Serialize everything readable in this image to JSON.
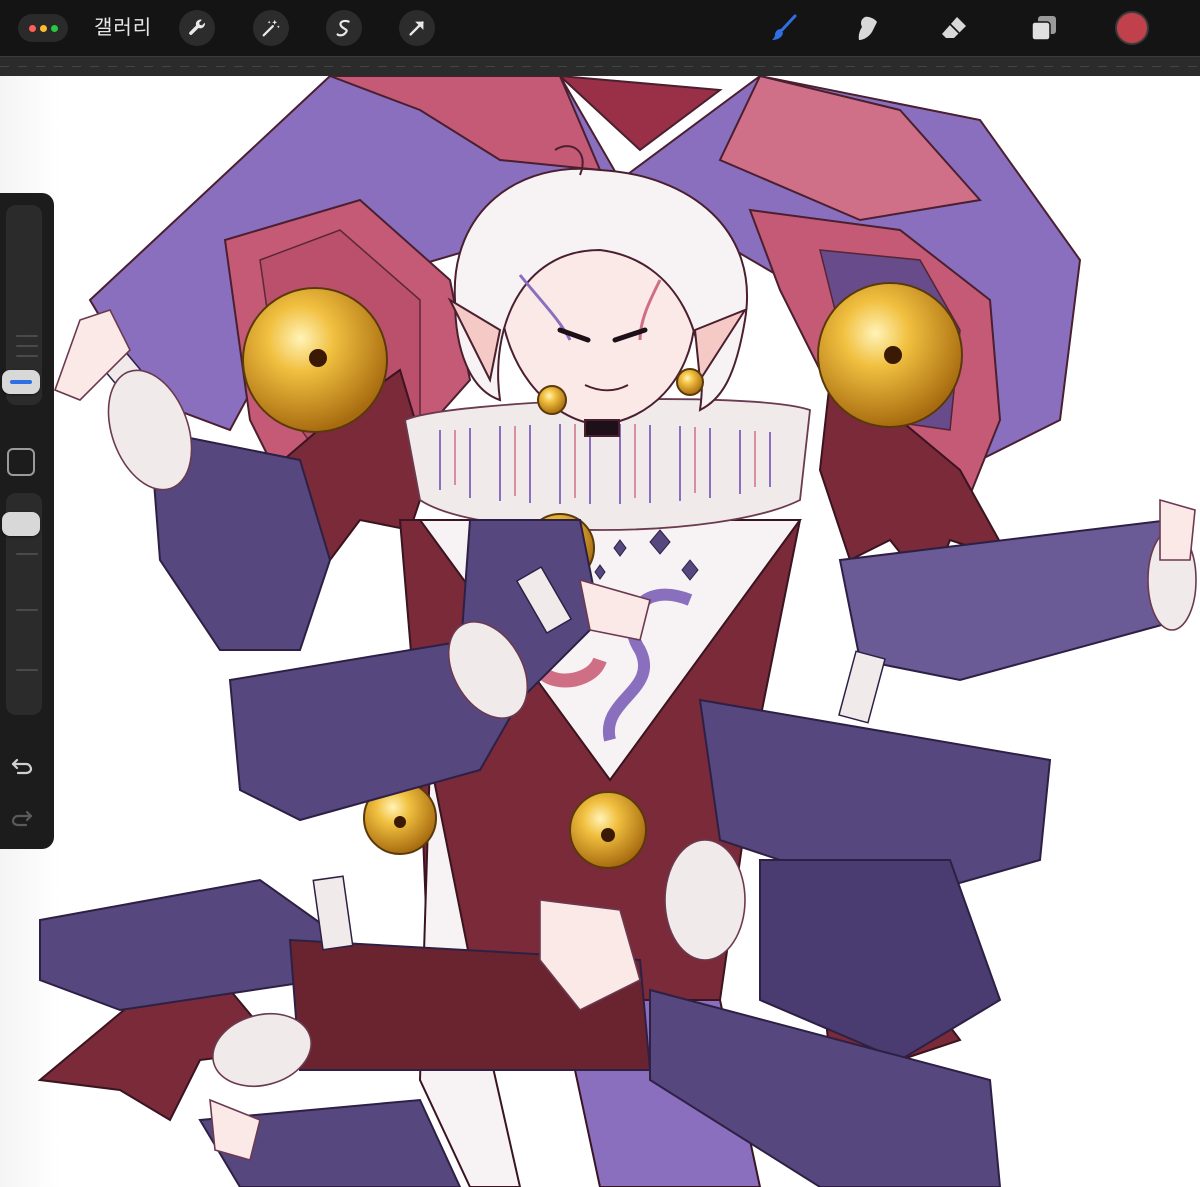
{
  "window": {
    "controls_icon": "three-dots-icon",
    "dot_colors": [
      "#ff5f57",
      "#febc2e",
      "#28c840"
    ]
  },
  "toolbar": {
    "gallery_label": "갤러리",
    "left_tools": [
      {
        "name": "actions",
        "icon": "wrench-icon"
      },
      {
        "name": "adjustments",
        "icon": "magic-wand-icon"
      },
      {
        "name": "selection",
        "icon": "selection-s-icon"
      },
      {
        "name": "transform",
        "icon": "arrow-cursor-icon"
      }
    ],
    "right_tools": [
      {
        "name": "brush",
        "icon": "brush-icon",
        "active": true
      },
      {
        "name": "smudge",
        "icon": "smudge-icon"
      },
      {
        "name": "eraser",
        "icon": "eraser-icon"
      },
      {
        "name": "layers",
        "icon": "layers-icon"
      }
    ],
    "current_color": "#c0404b",
    "accent_color": "#2f6fe4"
  },
  "sidebar": {
    "brush_size_slider": {
      "level": 0.27
    },
    "modify_button_icon": "square-icon",
    "opacity_slider": {
      "level": 0.0
    },
    "undo_icon": "undo-icon",
    "redo_icon": "redo-icon"
  },
  "canvas": {
    "artwork": "jester-illustration",
    "palette": {
      "hat_purple": "#8a6fbf",
      "hat_red": "#cf6f86",
      "dark_red": "#7a2a38",
      "sleeve_purple": "#56477e",
      "bell_gold": "#d9a21c",
      "ruff_white": "#f1eaea",
      "hair_white": "#f7f3f4"
    }
  }
}
